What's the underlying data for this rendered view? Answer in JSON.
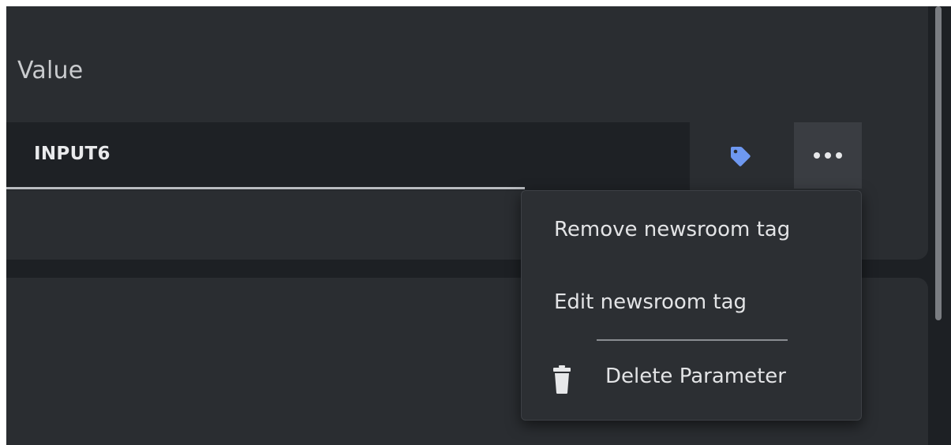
{
  "field": {
    "label": "Value",
    "value": "INPUT6"
  },
  "actions": {
    "tag_icon": "tag-icon",
    "tag_color": "#6e98f0",
    "more_icon": "more-horizontal-icon"
  },
  "menu": {
    "items": [
      {
        "label": "Remove newsroom tag"
      },
      {
        "label": "Edit newsroom tag"
      },
      {
        "label": "Delete Parameter",
        "icon": "trash-icon"
      }
    ]
  }
}
